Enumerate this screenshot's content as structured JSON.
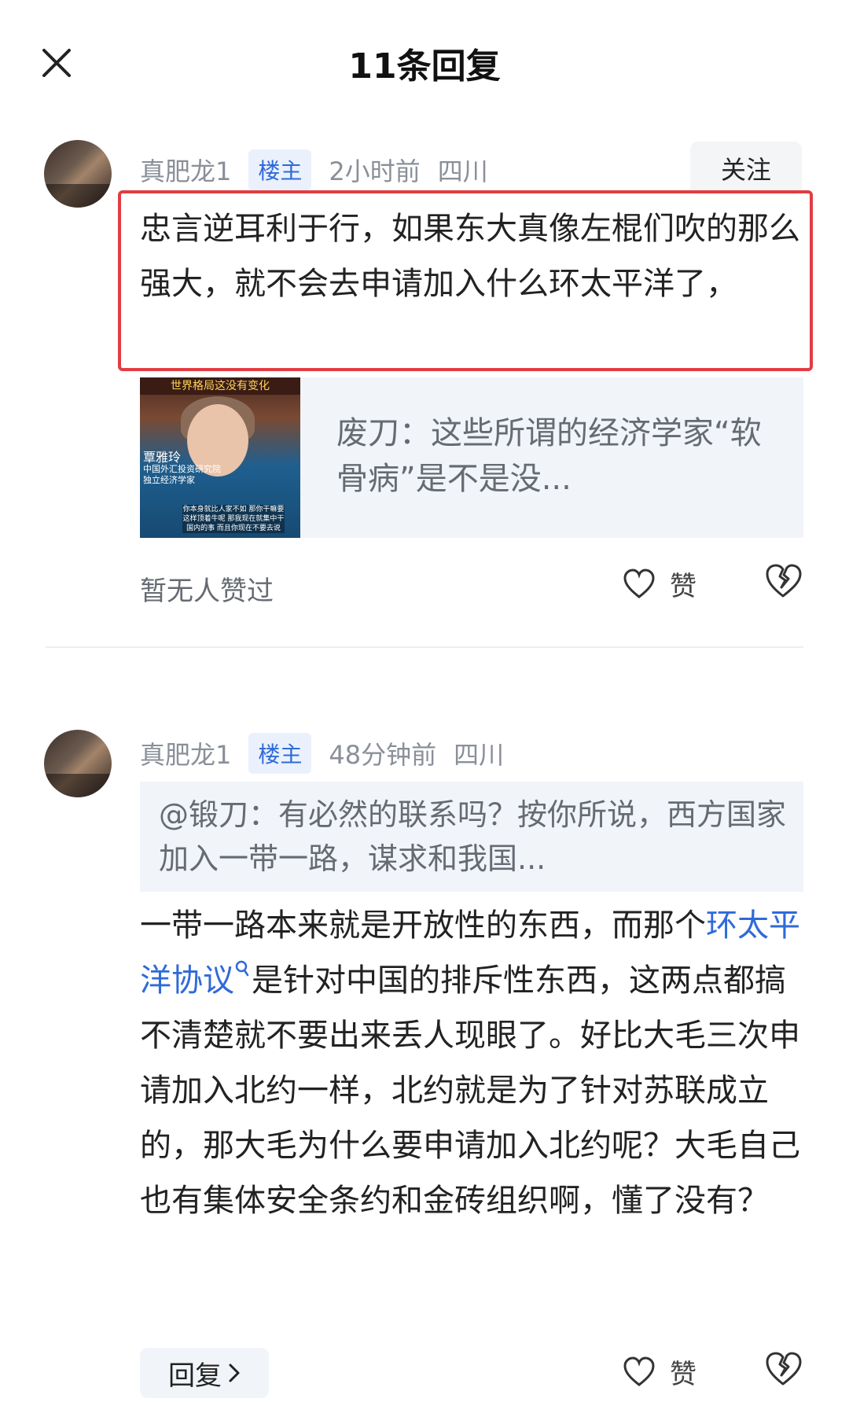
{
  "header": {
    "title": "11条回复"
  },
  "comments": [
    {
      "username": "真肥龙1",
      "badge": "楼主",
      "time": "2小时前",
      "location": "四川",
      "follow": "关注",
      "text": "忠言逆耳利于行，如果东大真像左棍们吹的那么强大，就不会去申请加入什么环太平洋了，",
      "shared": {
        "thumb_caption": "世界格局这没有变化",
        "thumb_name": "覃雅玲",
        "thumb_title": "中国外汇投资研究院 独立经济学家",
        "thumb_subtitle": "你本身就比人家不如 那你干嘛要这样顶着牛呢 那我现在就集中干国内的事 而且你现在不要去说",
        "text": "废刀：这些所谓的经济学家“软骨病”是不是没..."
      },
      "likes_text": "暂无人赞过",
      "like_label": "赞"
    },
    {
      "username": "真肥龙1",
      "badge": "楼主",
      "time": "48分钟前",
      "location": "四川",
      "quote": "@锻刀：有必然的联系吗？按你所说，西方国家加入一带一路，谋求和我国...",
      "text_before": "一带一路本来就是开放性的东西，而那个",
      "link": "环太平洋协议",
      "text_after": "是针对中国的排斥性东西，这两点都搞不清楚就不要出来丢人现眼了。好比大毛三次申请加入北约一样，北约就是为了针对苏联成立的，那大毛为什么要申请加入北约呢？大毛自己也有集体安全条约和金砖组织啊，懂了没有？",
      "reply_label": "回复",
      "like_label": "赞"
    }
  ],
  "colors": {
    "accent": "#2f6ad8",
    "highlight_border": "#e23c42",
    "meta_gray": "#8a8f99"
  },
  "icons": [
    "close-icon",
    "heart-icon",
    "broken-heart-icon",
    "chevron-right-icon",
    "search-mark-icon"
  ]
}
